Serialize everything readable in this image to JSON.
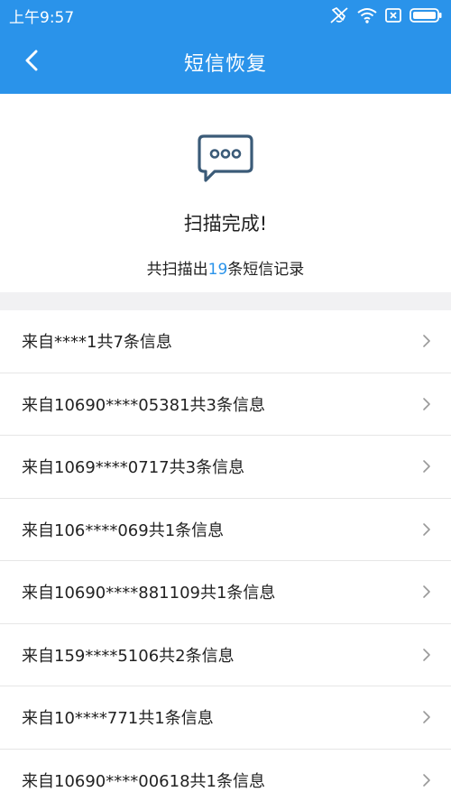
{
  "status_bar": {
    "time": "上午9:57",
    "icons": [
      "vibrate-off-icon",
      "wifi-icon",
      "sim-x-icon",
      "battery-icon"
    ]
  },
  "header": {
    "title": "短信恢复",
    "back_icon": "chevron-left-icon"
  },
  "summary": {
    "icon": "message-bubble-icon",
    "status": "扫描完成!",
    "count_prefix": "共扫描出",
    "count_value": "19",
    "count_suffix": "条短信记录"
  },
  "records": [
    {
      "label": "来自****1共7条信息"
    },
    {
      "label": "来自10690****05381共3条信息"
    },
    {
      "label": "来自1069****0717共3条信息"
    },
    {
      "label": "来自106****069共1条信息"
    },
    {
      "label": "来自10690****881109共1条信息"
    },
    {
      "label": "来自159****5106共2条信息"
    },
    {
      "label": "来自10****771共1条信息"
    },
    {
      "label": "来自10690****00618共1条信息"
    }
  ],
  "colors": {
    "accent": "#2a93ea",
    "band": "#f1f1f3",
    "text": "#222222"
  }
}
